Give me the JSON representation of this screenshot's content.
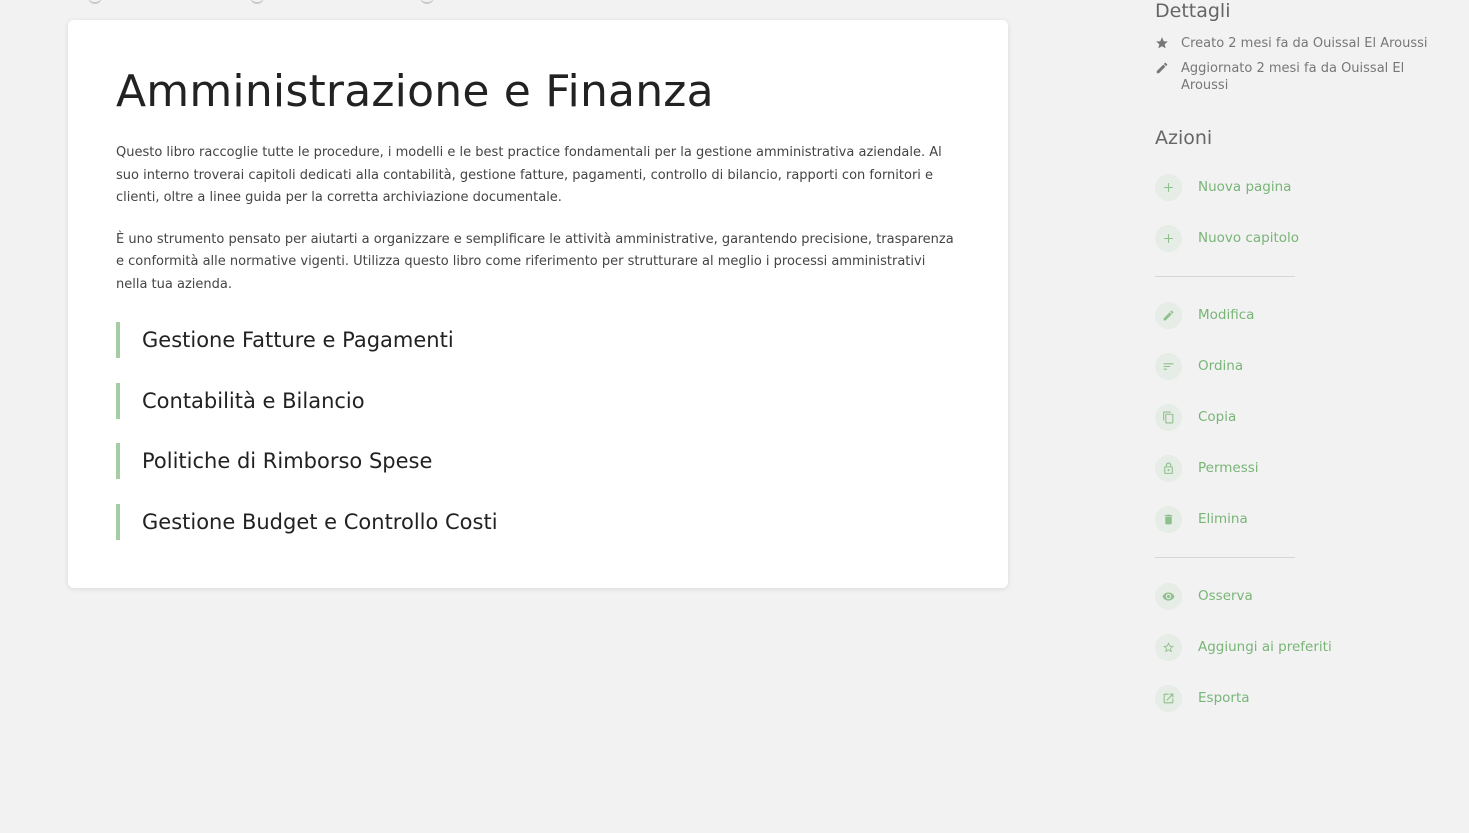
{
  "colors": {
    "accent": "#79b577",
    "chapter_border": "#a5cca3",
    "icon_circle": "#e6ece6",
    "background": "#f2f2f2"
  },
  "book": {
    "title": "Amministrazione e Finanza",
    "description": [
      "Questo libro raccoglie tutte le procedure, i modelli e le best practice fondamentali per la gestione amministrativa aziendale. Al suo interno troverai capitoli dedicati alla contabilità, gestione fatture, pagamenti, controllo di bilancio, rapporti con fornitori e clienti, oltre a linee guida per la corretta archiviazione documentale.",
      "È uno strumento pensato per aiutarti a organizzare e semplificare le attività amministrative, garantendo precisione, trasparenza e conformità alle normative vigenti. Utilizza questo libro come riferimento per strutturare al meglio i processi amministrativi nella tua azienda."
    ],
    "chapters": [
      "Gestione Fatture e Pagamenti",
      "Contabilità e Bilancio",
      "Politiche di Rimborso Spese",
      "Gestione Budget e Controllo Costi"
    ]
  },
  "sidebar": {
    "details_heading": "Dettagli",
    "details": [
      {
        "icon": "star-icon",
        "text": "Creato 2 mesi fa da Ouissal El Aroussi"
      },
      {
        "icon": "pencil-icon",
        "text": "Aggiornato 2 mesi fa da Ouissal El Aroussi"
      }
    ],
    "actions_heading": "Azioni",
    "actions": [
      {
        "icon": "plus-icon",
        "label": "Nuova pagina"
      },
      {
        "icon": "plus-icon",
        "label": "Nuovo capitolo"
      },
      {
        "icon": "pencil-icon",
        "label": "Modifica"
      },
      {
        "icon": "sort-icon",
        "label": "Ordina"
      },
      {
        "icon": "copy-icon",
        "label": "Copia"
      },
      {
        "icon": "lock-icon",
        "label": "Permessi"
      },
      {
        "icon": "trash-icon",
        "label": "Elimina"
      },
      {
        "icon": "eye-icon",
        "label": "Osserva"
      },
      {
        "icon": "star-outline-icon",
        "label": "Aggiungi ai preferiti"
      },
      {
        "icon": "export-icon",
        "label": "Esporta"
      }
    ]
  }
}
